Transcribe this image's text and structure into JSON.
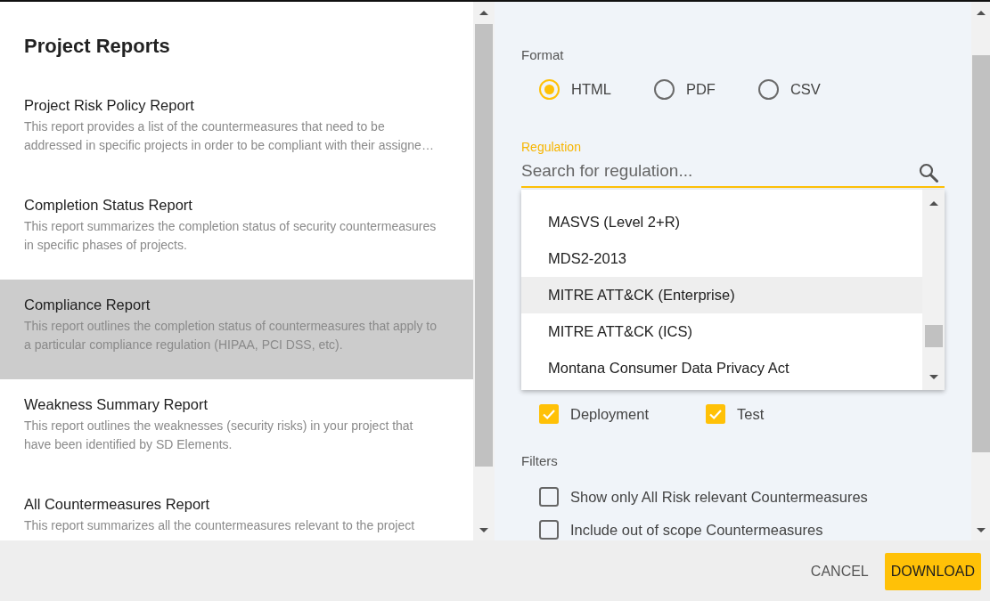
{
  "panel": {
    "title": "Project Reports",
    "reports": [
      {
        "title": "Project Risk Policy Report",
        "description": "This report provides a list of the countermeasures that need to be addressed in specific projects in order to be compliant with their assigne…",
        "selected": false
      },
      {
        "title": "Completion Status Report",
        "description": "This report summarizes the completion status of security countermeasures in specific phases of projects.",
        "selected": false
      },
      {
        "title": "Compliance Report",
        "description": "This report outlines the completion status of countermeasures that apply to a particular compliance regulation (HIPAA, PCI DSS, etc).",
        "selected": true
      },
      {
        "title": "Weakness Summary Report",
        "description": "This report outlines the weaknesses (security risks) in your project that have been identified by SD Elements.",
        "selected": false
      },
      {
        "title": "All Countermeasures Report",
        "description": "This report summarizes all the countermeasures relevant to the project",
        "selected": false
      }
    ]
  },
  "format": {
    "label": "Format",
    "options": [
      {
        "label": "HTML",
        "selected": true
      },
      {
        "label": "PDF",
        "selected": false
      },
      {
        "label": "CSV",
        "selected": false
      }
    ]
  },
  "regulation": {
    "label": "Regulation",
    "placeholder": "Search for regulation...",
    "options": [
      {
        "label": "MASVS (Level 2+R)",
        "selected": false
      },
      {
        "label": "MDS2-2013",
        "selected": false
      },
      {
        "label": "MITRE ATT&CK (Enterprise)",
        "selected": true
      },
      {
        "label": "MITRE ATT&CK (ICS)",
        "selected": false
      },
      {
        "label": "Montana Consumer Data Privacy Act",
        "selected": false
      }
    ]
  },
  "phases": [
    {
      "label": "Deployment",
      "checked": true
    },
    {
      "label": "Test",
      "checked": true
    }
  ],
  "filters": {
    "label": "Filters",
    "options": [
      {
        "label": "Show only All Risk relevant Countermeasures",
        "checked": false
      },
      {
        "label": "Include out of scope Countermeasures",
        "checked": false
      }
    ]
  },
  "buttons": [
    {
      "label": "CANCEL",
      "kind": "text"
    },
    {
      "label": "DOWNLOAD",
      "kind": "primary"
    }
  ]
}
